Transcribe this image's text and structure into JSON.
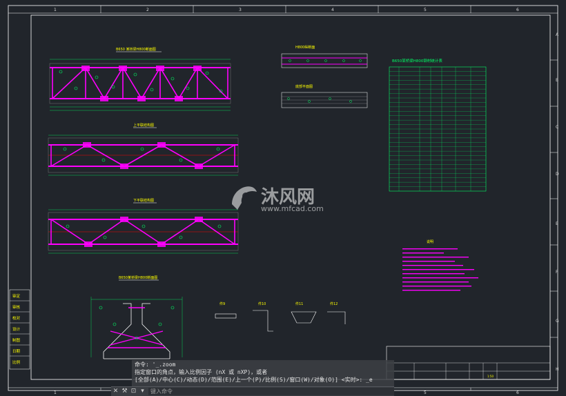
{
  "ruler": {
    "top_numbers": [
      "1",
      "2",
      "3",
      "4",
      "5",
      "6"
    ],
    "bottom_numbers": [
      "1",
      "2",
      "3",
      "4",
      "5",
      "6"
    ],
    "side_letters": [
      "A",
      "B",
      "C",
      "D",
      "E",
      "F",
      "G",
      "H"
    ]
  },
  "drawing": {
    "view_titles": [
      "B650 某桥梁H800断面图",
      "上平联结构图",
      "下平联结构图",
      "B650某桥梁H800断面图"
    ],
    "small_view_titles": [
      "H800纵断面",
      "底部平面图"
    ],
    "detail_labels": [
      "件9",
      "件10",
      "件11",
      "件12"
    ],
    "table_title": "B650某桥梁H800钢材统计表"
  },
  "stamps": [
    "审定",
    "审核",
    "校对",
    "设计",
    "制图",
    "日期",
    "比例"
  ],
  "watermark": {
    "brand": "沐风网",
    "url": "www.mfcad.com"
  },
  "titleblock": {
    "scale": "1:50"
  },
  "command": {
    "line1": "命令: '_.zoom",
    "line2": "指定窗口的角点，输入比例因子 (nX 或 nXP)，或者",
    "line3": "[全部(A)/中心(C)/动态(D)/范围(E)/上一个(P)/比例(S)/窗口(W)/对象(O)] <实时>: _e",
    "placeholder": "键入命令"
  },
  "colors": {
    "background": "#21252b",
    "frame": "#ffffff",
    "member": "#ff00ff",
    "label": "#ffff00",
    "dimension": "#00ff66",
    "accent": "#ff0000"
  }
}
